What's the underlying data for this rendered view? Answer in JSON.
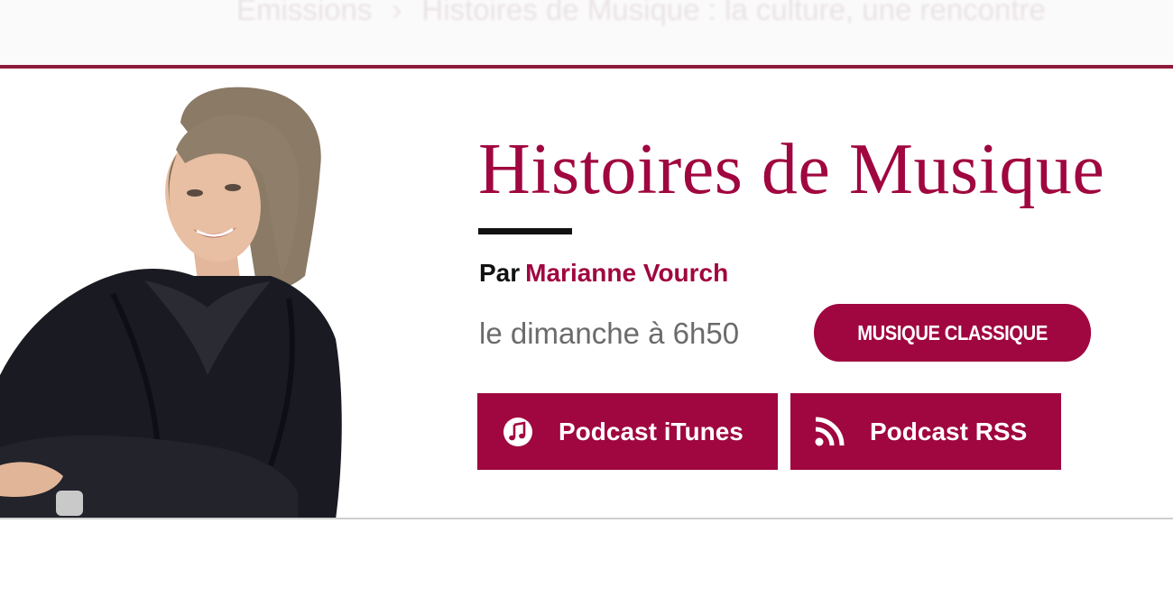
{
  "colors": {
    "accent": "#a0063f",
    "accent_rule": "#8e1b3a",
    "text_dark": "#111111",
    "text_muted": "#6b6b6b"
  },
  "breadcrumb": {
    "items": [
      "Émissions",
      "Histoires de Musique : la culture, une rencontre"
    ]
  },
  "show": {
    "title": "Histoires de Musique",
    "by_prefix": "Par",
    "host": "Marianne Vourch",
    "schedule": "le dimanche à 6h50",
    "genre": "MUSIQUE CLASSIQUE"
  },
  "buttons": {
    "itunes": {
      "label": "Podcast iTunes",
      "icon": "music-note-icon"
    },
    "rss": {
      "label": "Podcast RSS",
      "icon": "rss-icon"
    }
  },
  "portrait": {
    "alt": "host-portrait"
  }
}
